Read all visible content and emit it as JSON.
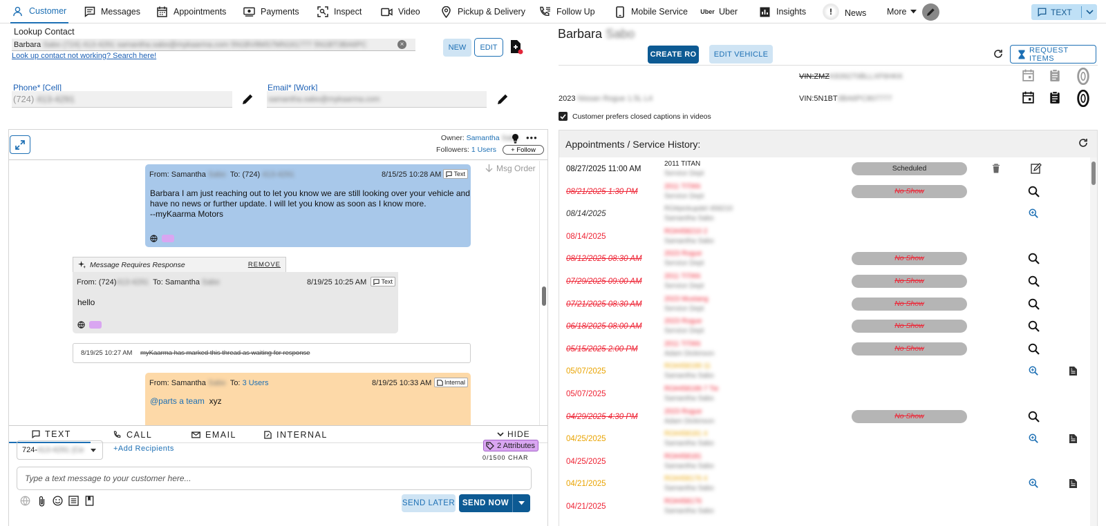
{
  "nav": {
    "items": [
      {
        "label": "Customer",
        "icon": "person-icon"
      },
      {
        "label": "Messages",
        "icon": "message-icon"
      },
      {
        "label": "Appointments",
        "icon": "calendar-icon"
      },
      {
        "label": "Payments",
        "icon": "payment-icon"
      },
      {
        "label": "Inspect",
        "icon": "inspect-icon"
      },
      {
        "label": "Video",
        "icon": "video-icon"
      },
      {
        "label": "Pickup & Delivery",
        "icon": "location-pin-icon"
      },
      {
        "label": "Follow Up",
        "icon": "phone-followup-icon"
      },
      {
        "label": "Mobile Service",
        "icon": "mobile-phone-icon"
      },
      {
        "label": "Uber",
        "icon": "uber-logo-icon"
      },
      {
        "label": "Insights",
        "icon": "bar-chart-icon"
      },
      {
        "label": "News",
        "icon": "alert-icon"
      },
      {
        "label": "More",
        "icon": "caret-down-icon"
      }
    ],
    "text_toggle": "TEXT",
    "uber_logo": "Uber",
    "news_badge": "!"
  },
  "lookup": {
    "label": "Lookup Contact",
    "first_name": "Barbara",
    "redacted_value": "Sabo (724) 413-4291 samantha.sabo@mykaarma.com 5N1BV8MS7MN161777 5N1BT3BA6PC",
    "link": "Look up contact not working? Search here!",
    "clear": "×",
    "new_btn": "NEW",
    "edit_btn": "EDIT"
  },
  "phone": {
    "label": "Phone* [Cell]",
    "prefix": "(724)",
    "redacted": "413-4291"
  },
  "email": {
    "label": "Email* [Work]",
    "redacted": "samantha.sabo@mykaarma.com"
  },
  "conversation": {
    "owner_label": "Owner:",
    "owner_first": "Samantha",
    "owner_last": "Sabo",
    "followers_label": "Followers:",
    "followers_value": "1 Users",
    "follow_btn": "+ Follow",
    "more": "•••",
    "msg_order": "Msg Order",
    "messages": [
      {
        "from_label": "From: Samantha",
        "from_last": "Sabo",
        "to_label": "To: (724)",
        "to_redacted": "413-4291",
        "date": "8/15/25 10:28 AM",
        "chip": "Text",
        "lines": [
          "Barbara  I am just reaching out to let you know we are still looking over your vehicle and",
          "have no news or further update. I will let you know as soon as I know more.",
          "--myKaarma Motors"
        ]
      },
      {
        "banner": "Message Requires Response",
        "banner_action": "REMOVE",
        "from_label": "From: (724)",
        "from_redacted": "413-4291",
        "to_label": "To: Samantha",
        "to_last": "Sabo",
        "date": "8/19/25 10:25 AM",
        "chip": "Text",
        "lines": [
          "hello"
        ]
      },
      {
        "system_date": "8/19/25 10:27 AM",
        "system_text": "myKaarma has marked this thread as waiting for response"
      },
      {
        "from_label": "From: Samantha",
        "from_last": "Sabo",
        "to_label": "To:",
        "to_value": "3 Users",
        "date": "8/19/25 10:33 AM",
        "chip": "Internal",
        "mention": "@parts a team",
        "text": "xyz"
      }
    ]
  },
  "composer": {
    "tabs": [
      {
        "label": "TEXT",
        "icon": "message-icon"
      },
      {
        "label": "CALL",
        "icon": "phone-icon"
      },
      {
        "label": "EMAIL",
        "icon": "email-icon"
      },
      {
        "label": "INTERNAL",
        "icon": "internal-note-icon"
      }
    ],
    "hide": "HIDE",
    "phone_prefix": "724-",
    "phone_redacted": "413-4291 (Ce",
    "add_recipients": "+Add Recipients",
    "attributes": "2 Attributes",
    "char_count": "0/1500 CHAR",
    "placeholder": "Type a text message to your customer here...",
    "send_later": "SEND LATER",
    "send_now": "SEND NOW"
  },
  "customer": {
    "first": "Barbara",
    "last": "Sabo"
  },
  "actions": {
    "create_ro": "CREATE RO",
    "edit_vehicle": "EDIT VEHICLE",
    "request_items": "REQUEST ITEMS"
  },
  "vehicles": [
    {
      "year": "",
      "model": "",
      "vin_label": "VIN:ZMZ",
      "vin_redacted": "K839270BLLXF6HKK",
      "strike": true
    },
    {
      "year": "2023",
      "model": "Nissan Rogue 1.5L L4",
      "vin_label": "VIN:5N1BT",
      "vin_redacted": "3BA6PC807777",
      "strike": false
    }
  ],
  "closed_captions": "Customer prefers closed captions in videos",
  "history": {
    "title": "Appointments / Service History:",
    "rows": [
      {
        "date": "08/27/2025 11:00 AM",
        "style": "black",
        "l1": "2011 TITAN",
        "l2": "Service Dept",
        "status": "Scheduled",
        "icons": "trash-edit"
      },
      {
        "date": "08/21/2025 1:30 PM",
        "style": "red-strike",
        "l1": "2011 TITAN",
        "l2": "Service Dept",
        "status": "No Show",
        "icons": "search"
      },
      {
        "date": "08/14/2025",
        "style": "gray-italic",
        "l1": "RO#pickupdel 458210",
        "l2": "Samantha Sabo",
        "status": "",
        "icons": "zoom-blue"
      },
      {
        "date": "08/14/2025",
        "style": "red",
        "l1": "RO#458210 2",
        "l2": "Samantha Sabo",
        "status": "",
        "icons": ""
      },
      {
        "date": "08/12/2025 08:30 AM",
        "style": "red-strike",
        "l1": "2023 Rogue",
        "l2": "Service Dept",
        "status": "No Show",
        "icons": "search"
      },
      {
        "date": "07/29/2025 09:00 AM",
        "style": "red-strike",
        "l1": "2011 TITAN",
        "l2": "Service Dept",
        "status": "No Show",
        "icons": "search"
      },
      {
        "date": "07/21/2025 08:30 AM",
        "style": "red-strike",
        "l1": "2023 Mustang",
        "l2": "Service Dept",
        "status": "No Show",
        "icons": "search"
      },
      {
        "date": "06/18/2025 08:00 AM",
        "style": "red-strike",
        "l1": "2023 Rogue",
        "l2": "Service Dept",
        "status": "No Show",
        "icons": "search"
      },
      {
        "date": "05/15/2025 2:00 PM",
        "style": "red-strike",
        "l1": "2011 TITAN",
        "l2": "Adam Dickinson",
        "status": "No Show",
        "icons": "search"
      },
      {
        "date": "05/07/2025",
        "style": "orange",
        "l1": "RO#458199 11",
        "l2": "Samantha Sabo",
        "status": "",
        "icons": "zoom-blue-doc"
      },
      {
        "date": "05/07/2025",
        "style": "red",
        "l1": "RO#458199 7 Tie",
        "l2": "Samantha Sabo",
        "status": "",
        "icons": ""
      },
      {
        "date": "04/29/2025 4:30 PM",
        "style": "red-strike",
        "l1": "2023 Rogue",
        "l2": "Adam Dickinson",
        "status": "No Show",
        "icons": "search"
      },
      {
        "date": "04/25/2025",
        "style": "orange",
        "l1": "RO#458181 4",
        "l2": "Samantha Sabo",
        "status": "",
        "icons": "zoom-blue-doc"
      },
      {
        "date": "04/25/2025",
        "style": "red",
        "l1": "RO#458181",
        "l2": "Samantha Sabo",
        "status": "",
        "icons": ""
      },
      {
        "date": "04/21/2025",
        "style": "orange",
        "l1": "RO#458176 4",
        "l2": "Samantha Sabo",
        "status": "",
        "icons": "zoom-blue-doc"
      },
      {
        "date": "04/21/2025",
        "style": "red",
        "l1": "RO#458176",
        "l2": "Samantha Sabo",
        "status": "",
        "icons": ""
      }
    ]
  },
  "colors": {
    "accent": "#1c6fb4",
    "dark_button": "#0d5a93",
    "text_bubble": "#a8c8ea",
    "internal_bubble": "#fdd9a8",
    "inbound_bubble": "#e8e8e8",
    "danger": "#e23",
    "warning": "#e9a300"
  }
}
